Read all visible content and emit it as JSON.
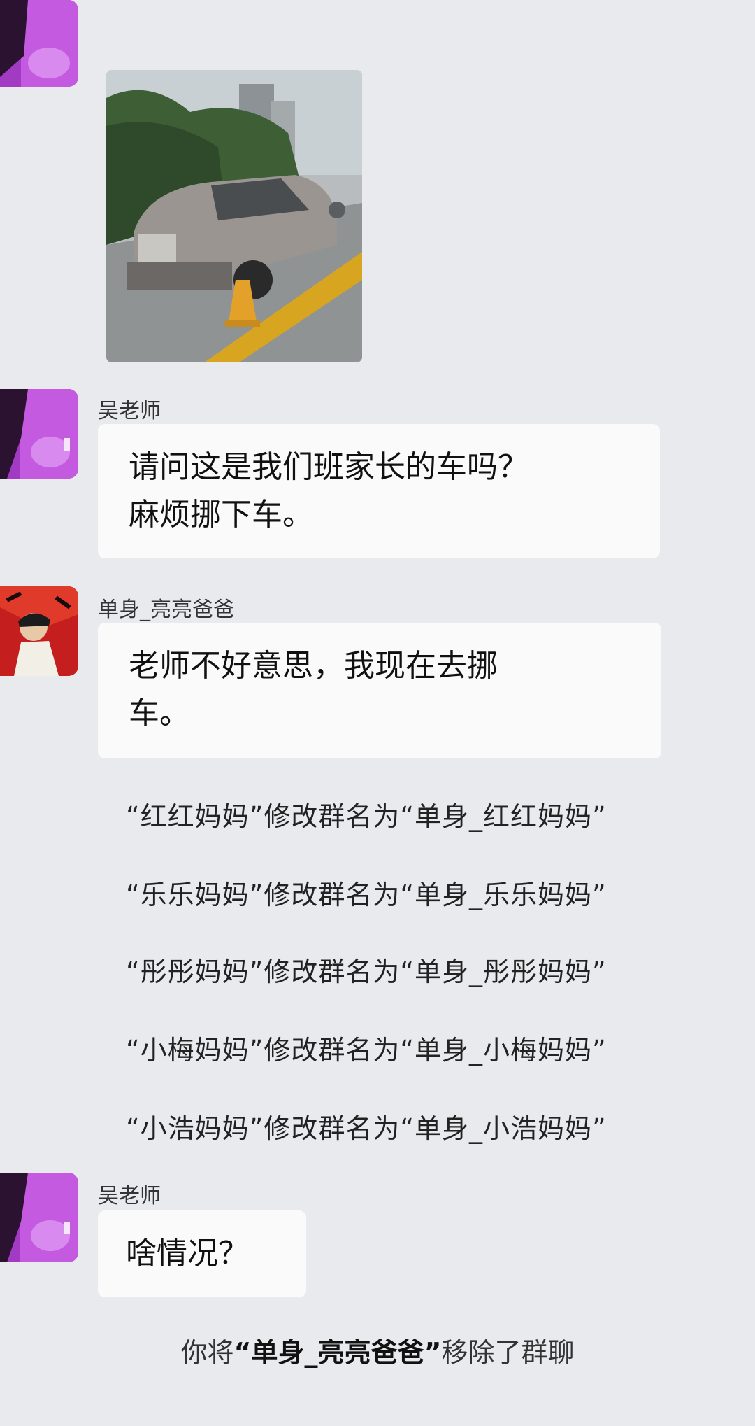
{
  "messages": [
    {
      "sender": "吴老师",
      "text_line1": "请问这是我们班家长的车吗？",
      "text_line2": "麻烦挪下车。"
    },
    {
      "sender": "单身_亮亮爸爸",
      "text_line1": "老师不好意思，我现在去挪",
      "text_line2": "车。"
    },
    {
      "sender": "吴老师",
      "text": "啥情况？"
    }
  ],
  "system_notices": [
    "“红红妈妈”修改群名为“单身_红红妈妈”",
    "“乐乐妈妈”修改群名为“单身_乐乐妈妈”",
    "“彤彤妈妈”修改群名为“单身_彤彤妈妈”",
    "“小梅妈妈”修改群名为“单身_小梅妈妈”",
    "“小浩妈妈”修改群名为“单身_小浩妈妈”"
  ],
  "removal_notice": {
    "prefix": "你将",
    "name": "“单身_亮亮爸爸”",
    "suffix": "移除了群聊"
  }
}
